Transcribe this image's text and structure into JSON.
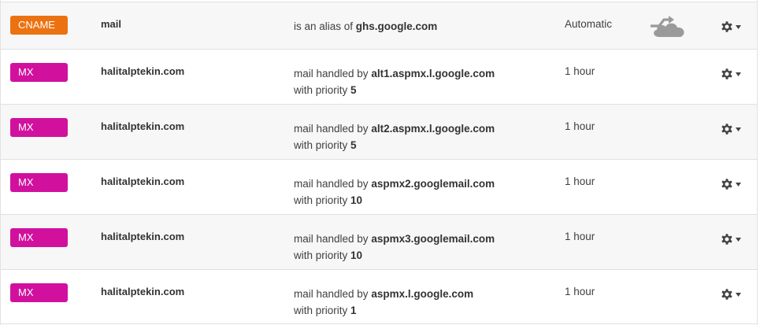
{
  "records": [
    {
      "type": "CNAME",
      "name": "mail",
      "value": {
        "line1_prefix": "is an alias of ",
        "line1_bold": "ghs.google.com",
        "line2_prefix": "",
        "line2_bold": ""
      },
      "ttl": "Automatic",
      "proxied": true
    },
    {
      "type": "MX",
      "name": "halitalptekin.com",
      "value": {
        "line1_prefix": "mail handled by ",
        "line1_bold": "alt1.aspmx.l.google.com",
        "line2_prefix": "with priority ",
        "line2_bold": "5"
      },
      "ttl": "1 hour",
      "proxied": false
    },
    {
      "type": "MX",
      "name": "halitalptekin.com",
      "value": {
        "line1_prefix": "mail handled by ",
        "line1_bold": "alt2.aspmx.l.google.com",
        "line2_prefix": "with priority ",
        "line2_bold": "5"
      },
      "ttl": "1 hour",
      "proxied": false
    },
    {
      "type": "MX",
      "name": "halitalptekin.com",
      "value": {
        "line1_prefix": "mail handled by ",
        "line1_bold": "aspmx2.googlemail.com",
        "line2_prefix": "with priority ",
        "line2_bold": "10"
      },
      "ttl": "1 hour",
      "proxied": false
    },
    {
      "type": "MX",
      "name": "halitalptekin.com",
      "value": {
        "line1_prefix": "mail handled by ",
        "line1_bold": "aspmx3.googlemail.com",
        "line2_prefix": "with priority ",
        "line2_bold": "10"
      },
      "ttl": "1 hour",
      "proxied": false
    },
    {
      "type": "MX",
      "name": "halitalptekin.com",
      "value": {
        "line1_prefix": "mail handled by ",
        "line1_bold": "aspmx.l.google.com",
        "line2_prefix": "with priority ",
        "line2_bold": "1"
      },
      "ttl": "1 hour",
      "proxied": false
    }
  ],
  "icons": {
    "cloud": "cloud-bypass-icon",
    "settings": "gear-icon",
    "caret": "caret-down-icon"
  },
  "colors": {
    "cname": "#ec7211",
    "mx": "#d1119e",
    "cloud": "#9a9a9a",
    "gear": "#444444"
  }
}
